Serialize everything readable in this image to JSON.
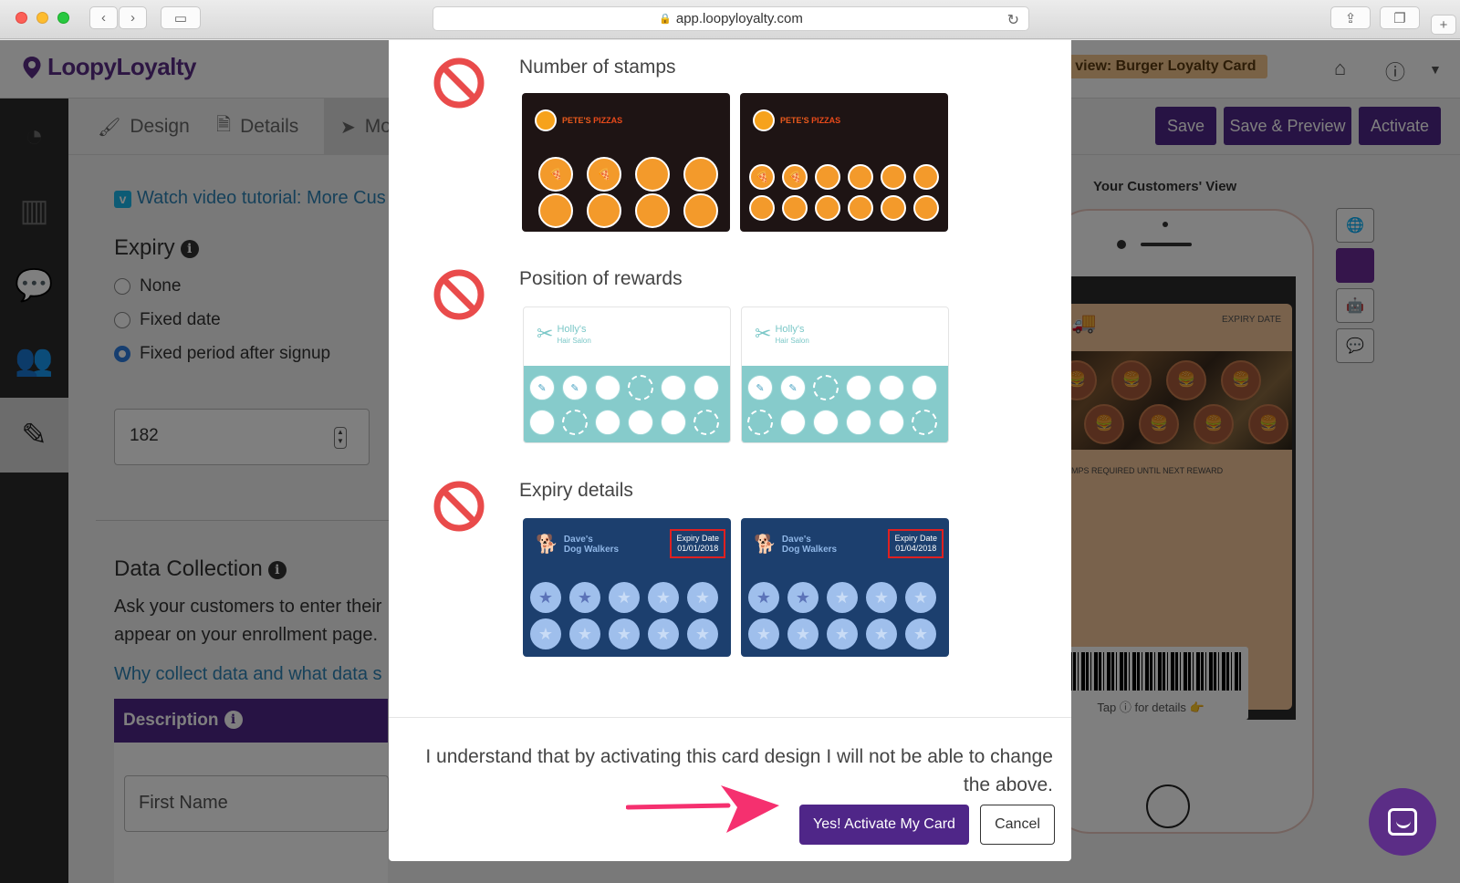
{
  "browser": {
    "url": "app.loopyloyalty.com"
  },
  "app": {
    "logo": "LoopyLoyalty",
    "view_badge": "n view: Burger Loyalty Card",
    "tabs": [
      {
        "label": "Design"
      },
      {
        "label": "Details"
      },
      {
        "label": "Mo"
      }
    ],
    "actions": {
      "save": "Save",
      "save_preview": "Save & Preview",
      "activate": "Activate"
    },
    "video_link": "Watch video tutorial: More Cus",
    "expiry": {
      "heading": "Expiry",
      "options": [
        "None",
        "Fixed date",
        "Fixed period after signup"
      ],
      "selected": "Fixed period after signup",
      "value": "182"
    },
    "data_collection": {
      "heading": "Data Collection",
      "line1": "Ask your customers to enter their",
      "line2": "appear on your enrollment page.",
      "link": "Why collect data and what data s",
      "table_header": "Description",
      "first_field": "First Name"
    },
    "preview": {
      "title": "Your Customers' View",
      "expiry_label": "EXPIRY DATE",
      "stamps_required": "MPS REQUIRED UNTIL NEXT REWARD",
      "tap_details": "Tap ⓘ for details 👉"
    }
  },
  "modal": {
    "rows": [
      {
        "title": "Number of stamps"
      },
      {
        "title": "Position of rewards"
      },
      {
        "title": "Expiry details"
      }
    ],
    "pizza_brand_a": "PETE'S",
    "pizza_brand_b": "PIZZAS",
    "salon_name": "Holly's",
    "salon_sub": "Hair Salon",
    "dog_name_1": "Dave's",
    "dog_name_2": "Dog Walkers",
    "expiry_label": "Expiry Date",
    "expiry_date_a": "01/01/2018",
    "expiry_date_b": "01/04/2018",
    "confirm_text": "I understand that by activating this card design I will not be able to change the above.",
    "yes_button": "Yes! Activate My Card",
    "cancel_button": "Cancel"
  },
  "colors": {
    "brand_purple": "#4f2688",
    "no_icon_red": "#e94b4b",
    "arrow_pink": "#f5306f"
  }
}
